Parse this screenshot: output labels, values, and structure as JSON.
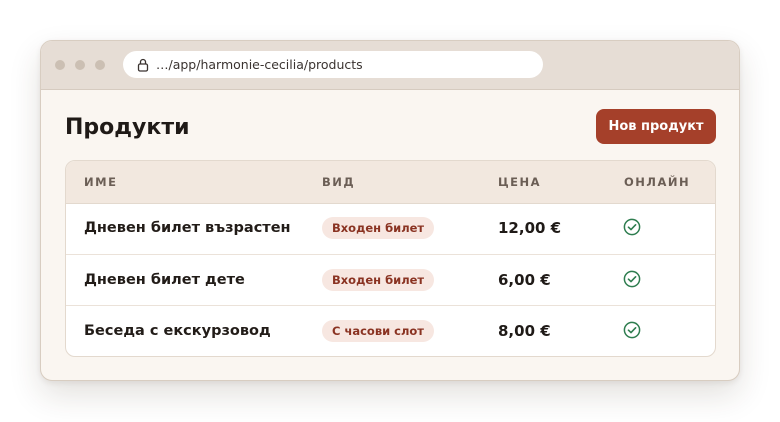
{
  "browser": {
    "url": "…/app/harmonie-cecilia/products"
  },
  "page": {
    "title": "Продукти",
    "new_button_label": "Нов продукт"
  },
  "table": {
    "columns": [
      "ИМЕ",
      "ВИД",
      "ЦЕНА",
      "ОНЛАЙН"
    ],
    "rows": [
      {
        "name": "Дневен билет възрастен",
        "type": "Входен билет",
        "price": "12,00 €",
        "online": true
      },
      {
        "name": "Дневен билет дете",
        "type": "Входен билет",
        "price": "6,00 €",
        "online": true
      },
      {
        "name": "Беседа с екскурзовод",
        "type": "С часови слот",
        "price": "8,00 €",
        "online": true
      }
    ]
  },
  "colors": {
    "accent": "#a5402a",
    "online_check": "#2e7d4f",
    "badge_bg": "#f7e7e1",
    "badge_text": "#8a3322"
  },
  "icons": {
    "lock": "lock-icon",
    "online": "check-circle-icon"
  }
}
